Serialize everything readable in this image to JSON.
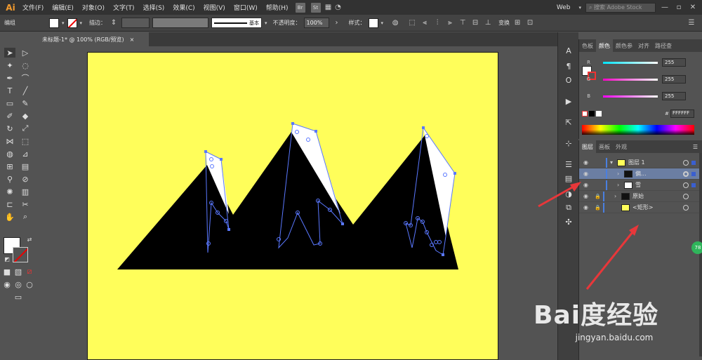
{
  "menubar": {
    "logo": "Ai",
    "items": [
      "文件(F)",
      "编辑(E)",
      "对象(O)",
      "文字(T)",
      "选择(S)",
      "效果(C)",
      "视图(V)",
      "窗口(W)",
      "帮助(H)"
    ],
    "badge_br": "Br",
    "badge_st": "St",
    "workspace": "Web",
    "search_placeholder": "搜索 Adobe Stock"
  },
  "controlbar": {
    "selection_label": "编组",
    "stroke_label": "描边：",
    "stroke_style": "基本",
    "opacity_label": "不透明度：",
    "opacity_value": "100%",
    "style_label": "样式：",
    "transform_label": "变换"
  },
  "document_tab": {
    "title": "未标题-1* @ 100% (RGB/预览)",
    "close": "×"
  },
  "color_panel": {
    "tabs": [
      "色板",
      "颜色",
      "颜色参",
      "对齐",
      "路径查"
    ],
    "active_tab": "颜色",
    "channels": [
      {
        "label": "R",
        "value": "255",
        "color": "#00e5ff"
      },
      {
        "label": "G",
        "value": "255",
        "color": "#ff00c8"
      },
      {
        "label": "B",
        "value": "255",
        "color": "#ff00ff"
      }
    ],
    "hex_label": "#",
    "hex_value": "FFFFFF"
  },
  "layers_panel": {
    "tabs": [
      "图层",
      "画板",
      "外观"
    ],
    "active_tab": "图层",
    "rows": [
      {
        "name": "图层 1",
        "thumb": "#111",
        "selected": false
      },
      {
        "name": "偏...",
        "thumb": "#111",
        "selected": true
      },
      {
        "name": "雪",
        "thumb": "#fff",
        "selected": false
      },
      {
        "name": "原始",
        "thumb": "#111",
        "selected": false
      },
      {
        "name": "<矩形>",
        "thumb": "#fffe5a",
        "selected": false
      }
    ]
  },
  "artwork": {
    "artboard_color": "#fffe5a",
    "mountain_color": "#000000",
    "snow_color": "#ffffff",
    "selection_color": "#5a78ff",
    "annotation_arrow_color": "#e8373a"
  },
  "badge_number": "78",
  "watermark": {
    "brand": "Bai度经验",
    "url": "jingyan.baidu.com"
  }
}
